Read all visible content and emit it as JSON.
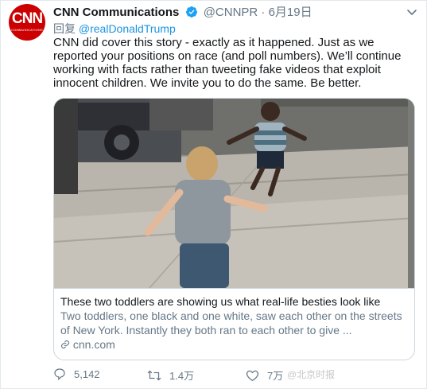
{
  "author": {
    "avatar_text": "CNN",
    "avatar_subtext": "COMMUNICATIONS",
    "name": "CNN Communications",
    "handle": "@CNNPR",
    "separator": "·",
    "date": "6月19日"
  },
  "reply_to": {
    "prefix": "回复",
    "mention": "@realDonaldTrump"
  },
  "tweet_text": "CNN did cover this story - exactly as it happened. Just as we reported your positions on race (and poll numbers). We’ll continue working with facts rather than tweeting fake videos that exploit innocent children. We invite you to do the same. Be better.",
  "card": {
    "title": "These two toddlers are showing us what real-life besties look like",
    "description": "Two toddlers, one black and one white, saw each other on the streets of New York. Instantly they both ran to each other to give ...",
    "link": "cnn.com"
  },
  "actions": {
    "replies": "5,142",
    "retweets": "1.4万",
    "likes": "7万"
  },
  "watermark": "@北京时报",
  "colors": {
    "link": "#1b95e0",
    "muted": "#657786",
    "avatar": "#cc0000"
  }
}
